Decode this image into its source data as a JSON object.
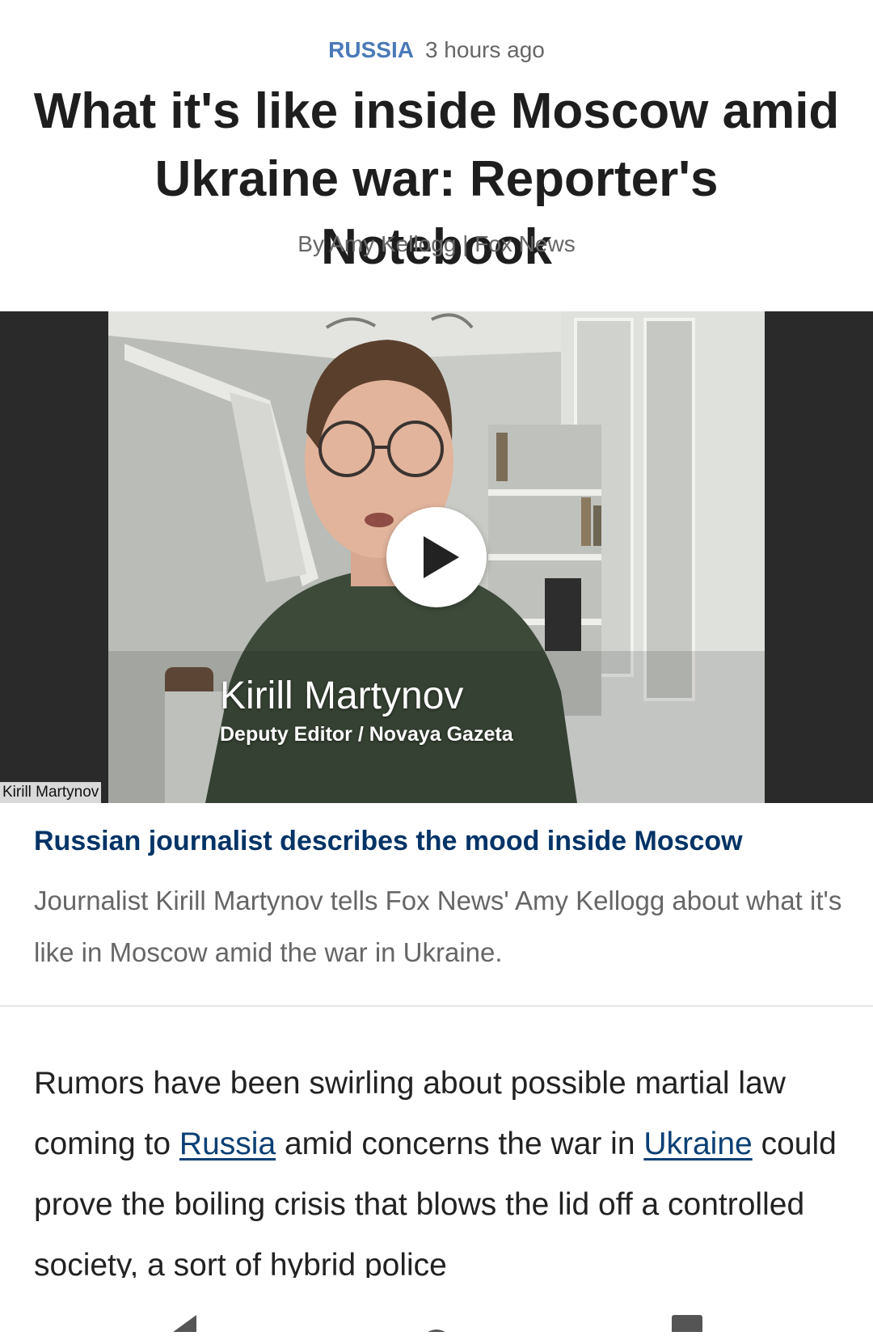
{
  "article": {
    "category": "RUSSIA",
    "timestamp": "3 hours ago",
    "headline": "What it's like inside Moscow amid Ukraine war: Reporter's Notebook",
    "byline": "By Amy Kellogg | Fox News"
  },
  "video": {
    "lower_third_name": "Kirill Martynov",
    "lower_third_title": "Deputy Editor / Novaya Gazeta",
    "participant_label": "Kirill Martynov",
    "title": "Russian journalist describes the mood inside Moscow",
    "description": "Journalist Kirill Martynov tells Fox News' Amy Kellogg about what it's like in Moscow amid the war in Ukraine."
  },
  "body": {
    "p1_start": "Rumors have been swirling about possible martial law coming to ",
    "link_russia": "Russia",
    "p1_mid": " amid concerns the war in ",
    "link_ukraine": "Ukraine",
    "p1_end": " could prove the boiling crisis that blows the lid off a controlled society, a sort of hybrid police"
  },
  "nav": {
    "back": "back-triangle",
    "home": "home-circle",
    "recents": "recents-square"
  },
  "colors": {
    "category": "#4a7ab8",
    "video_title": "#003366",
    "link": "#0a3f75",
    "letterbox": "#2a2a2a"
  }
}
